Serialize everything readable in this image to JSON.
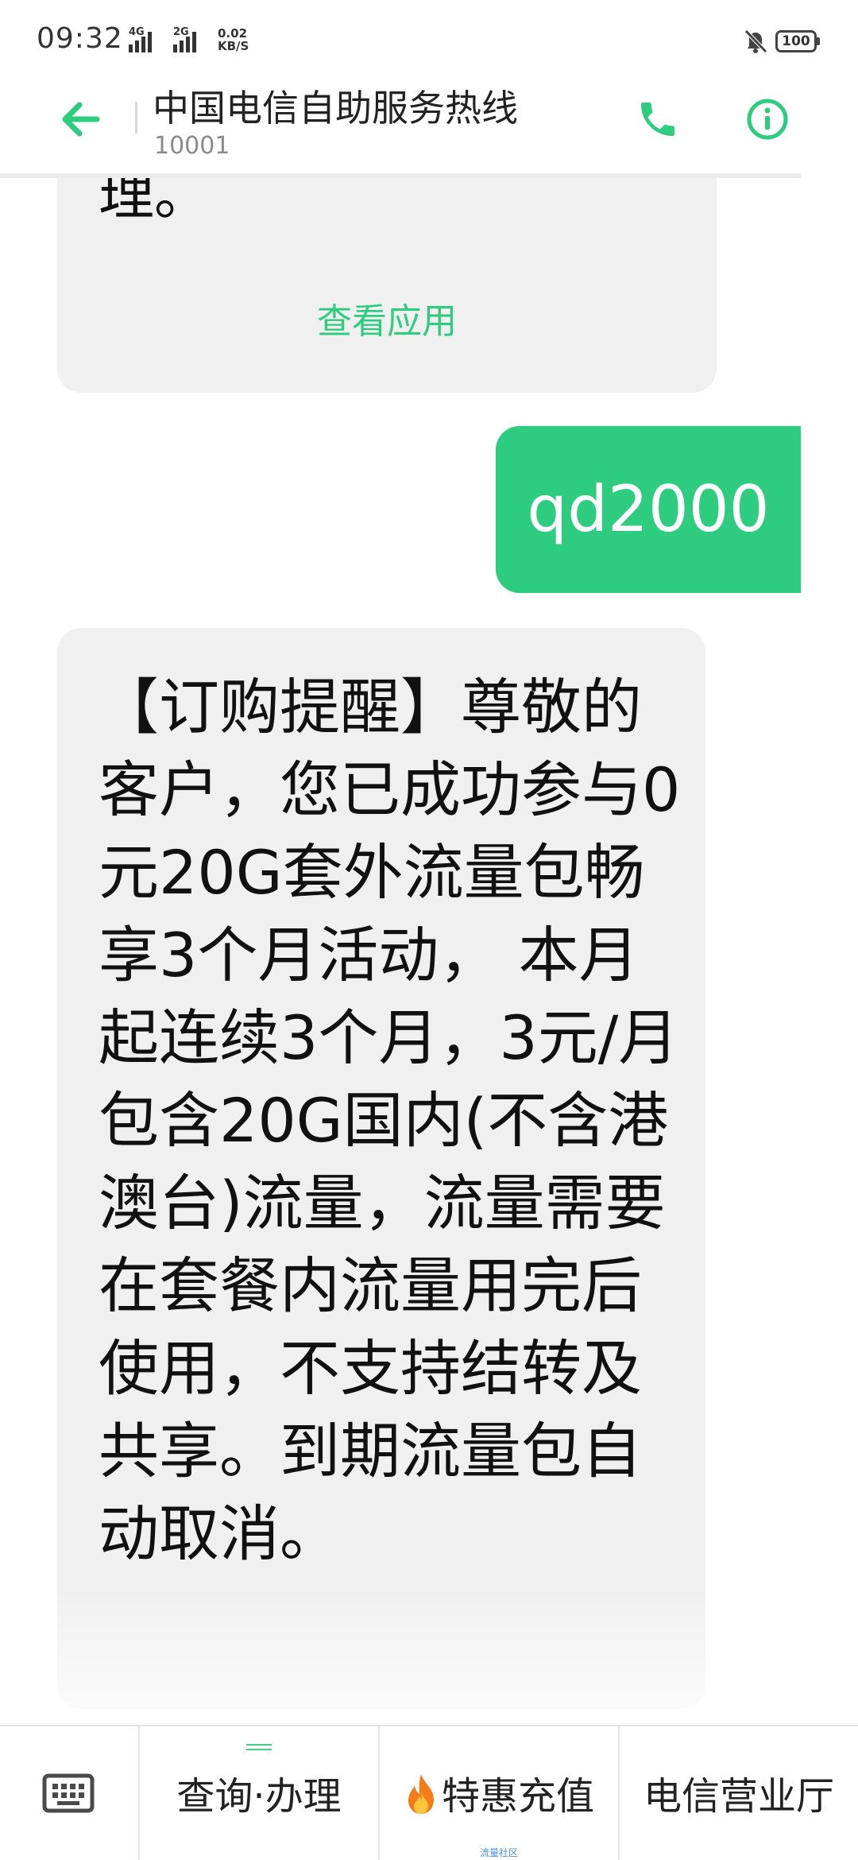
{
  "status_bar": {
    "time": "09:32",
    "signal_1": "4G",
    "signal_2": "2G",
    "net_speed_value": "0.02",
    "net_speed_unit": "KB/S",
    "battery": "100"
  },
  "header": {
    "title": "中国电信自助服务热线",
    "number": "10001"
  },
  "messages": {
    "previous_tail": "理。",
    "view_app": "查看应用",
    "sent": "qd2000",
    "received": "【订购提醒】尊敬的客户，您已成功参与0元20G套外流量包畅享3个月活动， 本月起连续3个月，3元/月包含20G国内(不含港澳台)流量，流量需要在套餐内流量用完后使用，不支持结转及共享。到期流量包自动取消。"
  },
  "bottom_menu": {
    "items": [
      {
        "label": "查询·办理"
      },
      {
        "label": "特惠充值"
      },
      {
        "label": "电信营业厅"
      }
    ],
    "caption": "流量社区"
  },
  "colors": {
    "accent": "#2ecc7f",
    "bubble_in": "#f0f0f0"
  },
  "icons": [
    "back-arrow-icon",
    "phone-icon",
    "info-icon",
    "mute-icon",
    "keyboard-icon",
    "fire-icon"
  ]
}
